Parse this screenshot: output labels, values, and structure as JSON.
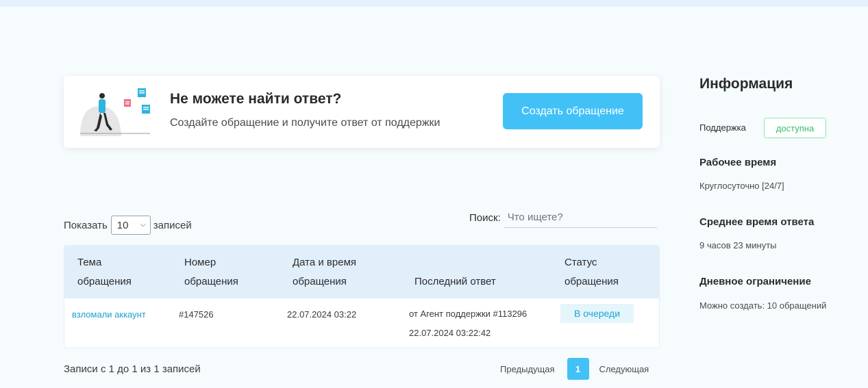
{
  "cta": {
    "title": "Не можете найти ответ?",
    "subtitle": "Создайте обращение и получите ответ от поддержки",
    "button_label": "Создать обращение"
  },
  "controls": {
    "show_label": "Показать",
    "page_size": "10",
    "records_label": "записей",
    "search_label": "Поиск:",
    "search_placeholder": "Что ищете?"
  },
  "table": {
    "headers": {
      "topic_line1": "Тема",
      "topic_line2": "обращения",
      "number_line1": "Номер",
      "number_line2": "обращения",
      "date_line1": "Дата и время",
      "date_line2": "обращения",
      "last": "Последний ответ",
      "status_line1": "Статус",
      "status_line2": "обращения"
    },
    "rows": [
      {
        "topic": "взломали аккаунт",
        "number": "#147526",
        "date": "22.07.2024 03:22",
        "last_line1": "от Агент поддержки #113296",
        "last_line2": "22.07.2024 03:22:42",
        "status": "В очереди"
      }
    ]
  },
  "footer": {
    "records_info": "Записи с 1 до 1 из 1 записей",
    "prev_label": "Предыдущая",
    "current_page": "1",
    "next_label": "Следующая"
  },
  "sidebar": {
    "title": "Информация",
    "support_label": "Поддержка",
    "support_status": "доступна",
    "work_time_heading": "Рабочее время",
    "work_time_value": "Круглосуточно [24/7]",
    "avg_response_heading": "Среднее время ответа",
    "avg_response_value": "9 часов 23 минуты",
    "daily_limit_heading": "Дневное ограничение",
    "daily_limit_value": "Можно создать: 10 обращений"
  },
  "colors": {
    "accent": "#42c1f7",
    "link": "#1a9fd0",
    "success": "#2fc069",
    "table_header_bg": "#e1effb"
  }
}
